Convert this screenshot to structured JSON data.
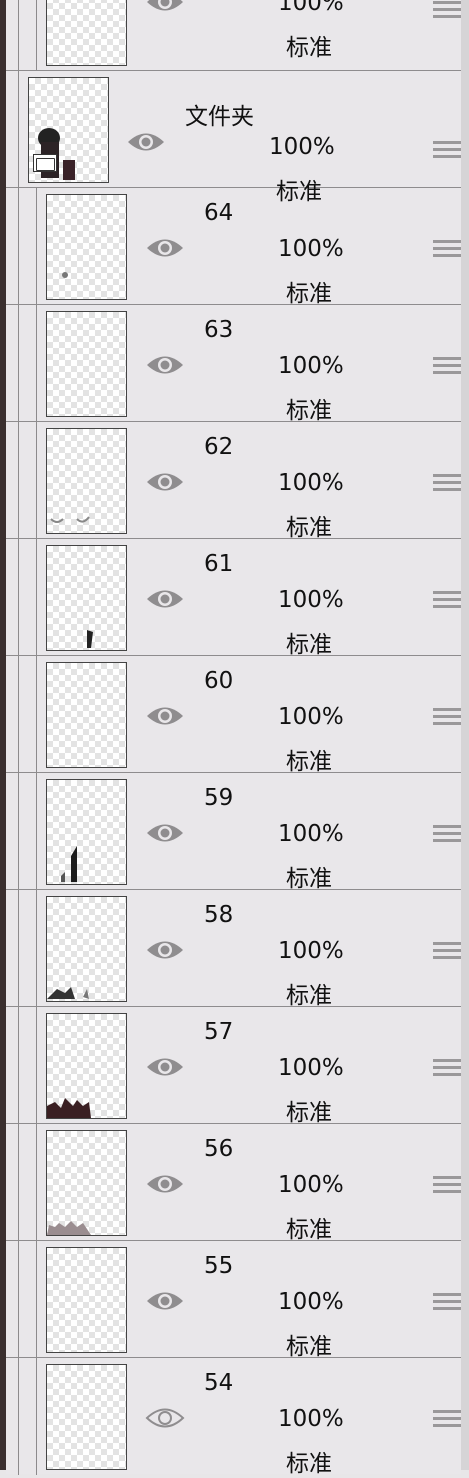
{
  "layers": [
    {
      "name": "",
      "opacity": "100%",
      "blend": "标准",
      "type": "layer",
      "visible": true
    },
    {
      "name": "文件夹",
      "opacity": "100%",
      "blend": "标准",
      "type": "folder",
      "visible": true
    },
    {
      "name": "64",
      "opacity": "100%",
      "blend": "标准",
      "type": "layer",
      "visible": true
    },
    {
      "name": "63",
      "opacity": "100%",
      "blend": "标准",
      "type": "layer",
      "visible": true
    },
    {
      "name": "62",
      "opacity": "100%",
      "blend": "标准",
      "type": "layer",
      "visible": true
    },
    {
      "name": "61",
      "opacity": "100%",
      "blend": "标准",
      "type": "layer",
      "visible": true
    },
    {
      "name": "60",
      "opacity": "100%",
      "blend": "标准",
      "type": "layer",
      "visible": true
    },
    {
      "name": "59",
      "opacity": "100%",
      "blend": "标准",
      "type": "layer",
      "visible": true
    },
    {
      "name": "58",
      "opacity": "100%",
      "blend": "标准",
      "type": "layer",
      "visible": true
    },
    {
      "name": "57",
      "opacity": "100%",
      "blend": "标准",
      "type": "layer",
      "visible": true
    },
    {
      "name": "56",
      "opacity": "100%",
      "blend": "标准",
      "type": "layer",
      "visible": true
    },
    {
      "name": "55",
      "opacity": "100%",
      "blend": "标准",
      "type": "layer",
      "visible": true
    },
    {
      "name": "54",
      "opacity": "100%",
      "blend": "标准",
      "type": "layer",
      "visible": false
    }
  ],
  "icons": {
    "visibility": "eye-icon",
    "visibility_off": "eye-outline-icon",
    "folder": "folder-icon",
    "drag": "drag-handle-icon"
  },
  "colors": {
    "panel_bg": "#e9e7ea",
    "divider": "#8e8c8e",
    "eye": "#8f8d8f"
  }
}
